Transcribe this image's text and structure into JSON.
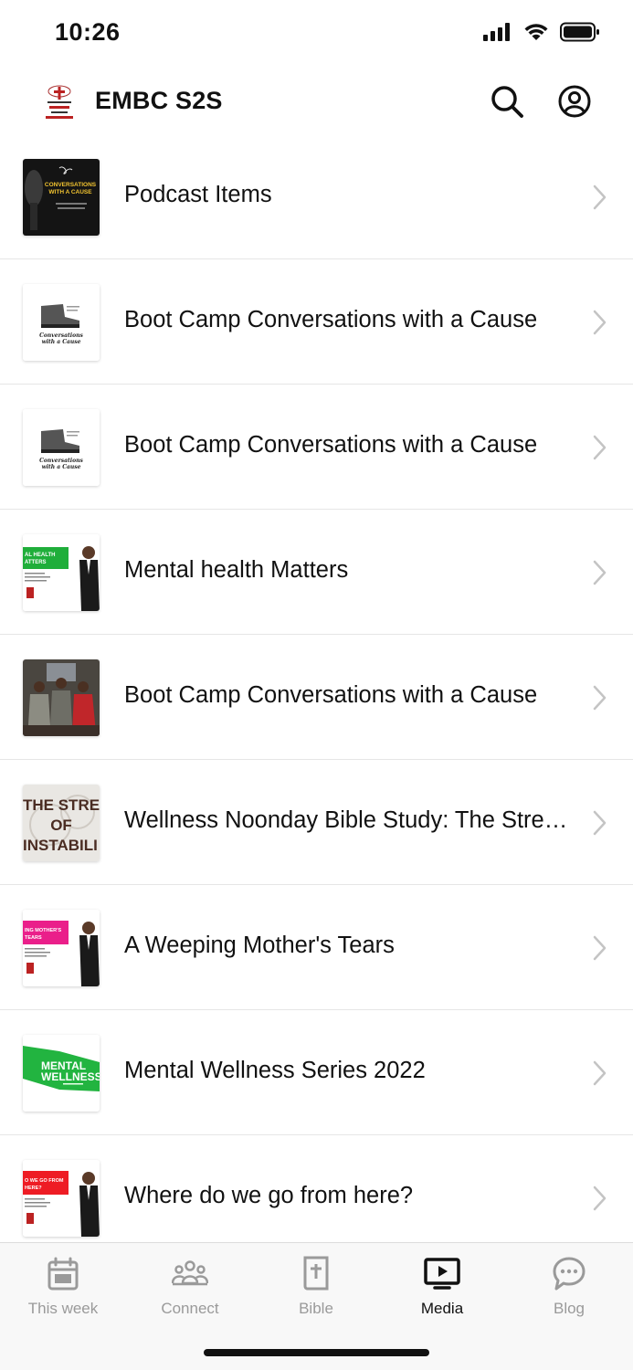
{
  "status_bar": {
    "time": "10:26"
  },
  "header": {
    "title": "EMBC S2S",
    "logo_icon": "church-logo-icon",
    "search_icon": "search-icon",
    "profile_icon": "profile-icon"
  },
  "media_items": [
    {
      "title": "Podcast Items",
      "thumb_text": [
        "CONVERSATIONS",
        "WITH A CAUSE"
      ]
    },
    {
      "title": "Boot Camp Conversations with a Cause",
      "thumb_text": [
        "Conversations",
        "with a Cause"
      ]
    },
    {
      "title": "Boot Camp Conversations with a Cause",
      "thumb_text": [
        "Conversations",
        "with a Cause"
      ]
    },
    {
      "title": "Mental health Matters",
      "thumb_text": [
        "AL HEALTH",
        "ATTERS"
      ]
    },
    {
      "title": "Boot Camp Conversations with a Cause",
      "thumb_text": []
    },
    {
      "title": "Wellness Noonday Bible Study: The Stress of Instability",
      "thumb_text": [
        "THE STRE",
        "OF",
        "INSTABILI"
      ]
    },
    {
      "title": "A Weeping Mother's Tears",
      "thumb_text": [
        "ING MOTHER'S",
        "TEARS"
      ]
    },
    {
      "title": "Mental Wellness Series 2022",
      "thumb_text": [
        "MENTAL",
        "WELLNESS"
      ]
    },
    {
      "title": "Where do we go from here?",
      "thumb_text": [
        "O WE GO FROM",
        "HERE?"
      ]
    }
  ],
  "tabs": [
    {
      "label": "This week",
      "icon": "calendar-icon",
      "active": false
    },
    {
      "label": "Connect",
      "icon": "people-icon",
      "active": false
    },
    {
      "label": "Bible",
      "icon": "bible-icon",
      "active": false
    },
    {
      "label": "Media",
      "icon": "media-play-icon",
      "active": true
    },
    {
      "label": "Blog",
      "icon": "chat-bubble-icon",
      "active": false
    }
  ],
  "colors": {
    "active": "#111111",
    "inactive": "#9a9a9a",
    "divider": "#e6e6e6",
    "chevron": "#c4c4c4"
  }
}
